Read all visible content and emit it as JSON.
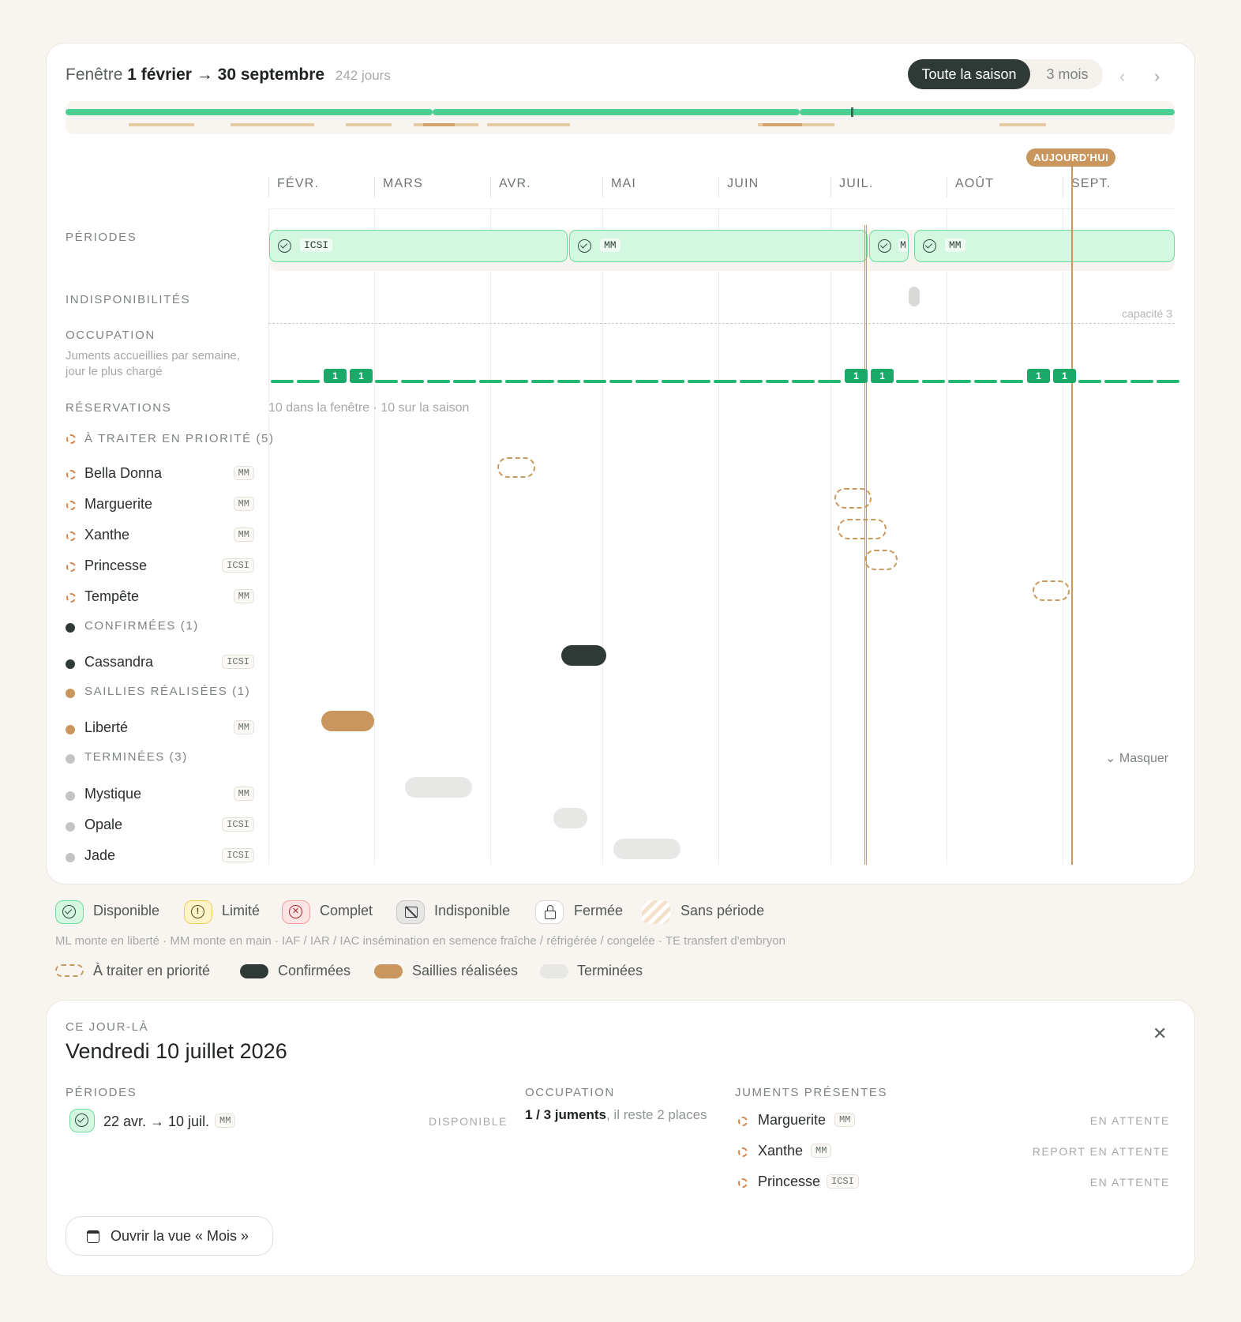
{
  "window": {
    "prefix": "Fenêtre",
    "start": "1 février",
    "arrow": "→",
    "end": "30 septembre",
    "days": "242 jours"
  },
  "view_toggle": {
    "season_label": "Toute la saison",
    "three_months_label": "3 mois"
  },
  "today_badge": "AUJOURD'HUI",
  "months": [
    "FÉVR.",
    "MARS",
    "AVR.",
    "MAI",
    "JUIN",
    "JUIL.",
    "AOÛT",
    "SEPT."
  ],
  "sections": {
    "periods": "PÉRIODES",
    "unavailability": "INDISPONIBILITÉS",
    "occupation": "OCCUPATION",
    "occupation_sub": "Juments accueillies par semaine, jour le plus chargé",
    "capacity": "capacité 3",
    "reservations": "RÉSERVATIONS",
    "reservations_summary": "10 dans la fenêtre · 10 sur la saison",
    "hide_label": "Masquer"
  },
  "periods": [
    {
      "tag": "ICSI",
      "status": "available"
    },
    {
      "tag": "MM",
      "status": "available"
    },
    {
      "tag": "M",
      "status": "available"
    },
    {
      "tag": "MM",
      "status": "available"
    }
  ],
  "occupation_counts": [
    "1",
    "1",
    "1",
    "1",
    "1",
    "1"
  ],
  "groups": {
    "priority": {
      "label": "À TRAITER EN PRIORITÉ (5)",
      "color": "#d4874f"
    },
    "confirmed": {
      "label": "CONFIRMÉES (1)",
      "color": "#2f3a36"
    },
    "done": {
      "label": "SAILLIES RÉALISÉES (1)",
      "color": "#c9965e"
    },
    "finished": {
      "label": "TERMINÉES (3)",
      "color": "#c4c4c3"
    }
  },
  "reservations": [
    {
      "name": "Bella Donna",
      "tag": "MM",
      "group": "priority"
    },
    {
      "name": "Marguerite",
      "tag": "MM",
      "group": "priority"
    },
    {
      "name": "Xanthe",
      "tag": "MM",
      "group": "priority"
    },
    {
      "name": "Princesse",
      "tag": "ICSI",
      "group": "priority"
    },
    {
      "name": "Tempête",
      "tag": "MM",
      "group": "priority"
    },
    {
      "name": "Cassandra",
      "tag": "ICSI",
      "group": "confirmed"
    },
    {
      "name": "Liberté",
      "tag": "MM",
      "group": "done"
    },
    {
      "name": "Mystique",
      "tag": "MM",
      "group": "finished"
    },
    {
      "name": "Opale",
      "tag": "ICSI",
      "group": "finished"
    },
    {
      "name": "Jade",
      "tag": "ICSI",
      "group": "finished"
    }
  ],
  "legend": {
    "available": "Disponible",
    "limited": "Limité",
    "full": "Complet",
    "unavailable": "Indisponible",
    "closed": "Fermée",
    "no_period": "Sans période",
    "abbreviations": "ML monte en liberté · MM monte en main · IAF / IAR / IAC insémination en semence fraîche / réfrigérée / congelée · TE transfert d'embryon",
    "priority": "À traiter en priorité",
    "confirmed": "Confirmées",
    "done": "Saillies réalisées",
    "finished": "Terminées"
  },
  "day_panel": {
    "eyebrow": "CE JOUR-LÀ",
    "title": "Vendredi 10 juillet 2026",
    "periods_heading": "PÉRIODES",
    "period_range": "22 avr. → 10 juil.",
    "period_tag": "MM",
    "period_status": "DISPONIBLE",
    "occupation_heading": "OCCUPATION",
    "occupation_strong": "1 / 3 juments",
    "occupation_rest": ", il reste 2 places",
    "mares_heading": "JUMENTS PRÉSENTES",
    "mares": [
      {
        "name": "Marguerite",
        "tag": "MM",
        "status": "EN ATTENTE"
      },
      {
        "name": "Xanthe",
        "tag": "MM",
        "status": "REPORT EN ATTENTE"
      },
      {
        "name": "Princesse",
        "tag": "ICSI",
        "status": "EN ATTENTE"
      }
    ],
    "open_month_label": "Ouvrir la vue « Mois »"
  },
  "colors": {
    "accent_green": "#22b872",
    "pending_orange": "#d4874f",
    "confirmed_dark": "#2f3a36",
    "done_tan": "#c9965e",
    "today_line": "#c9965e"
  }
}
